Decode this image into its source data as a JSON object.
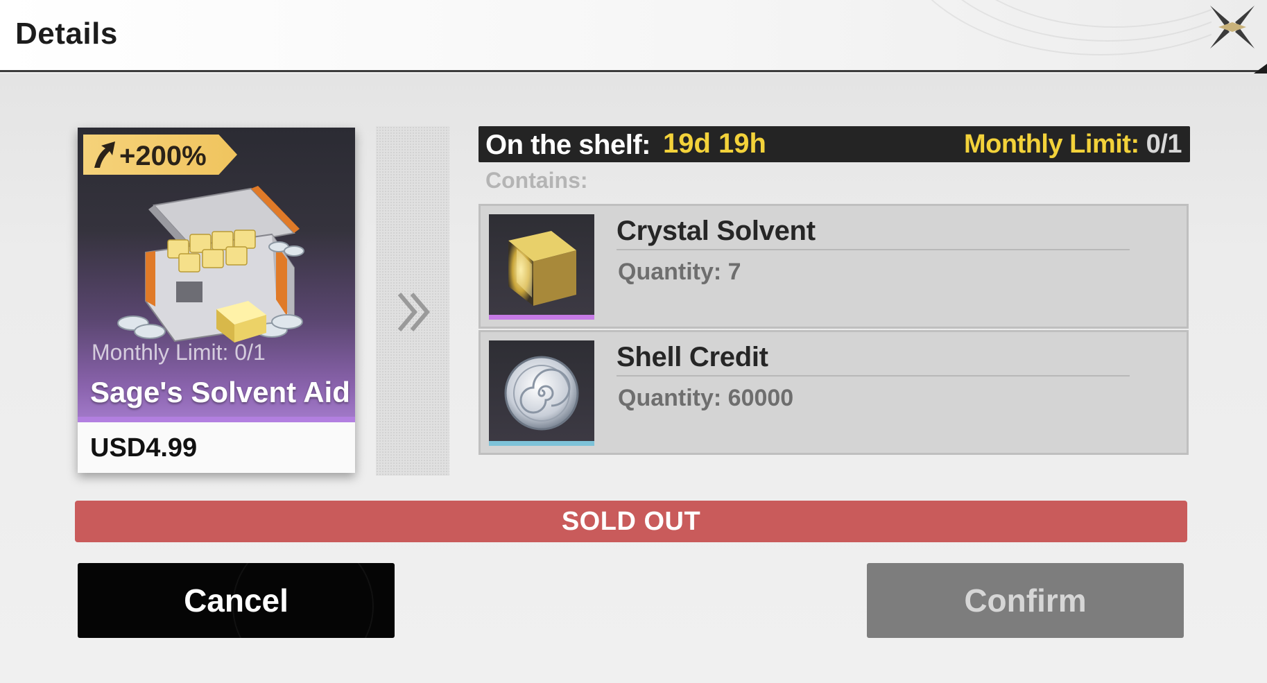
{
  "header": {
    "title": "Details",
    "close_icon": "close-x-icon"
  },
  "product": {
    "bonus": "+200%",
    "bonus_icon": "arrow-up-icon",
    "monthly_limit": "Monthly Limit: 0/1",
    "name": "Sage's Solvent Aid",
    "price": "USD4.99",
    "image": "treasure-chest-icon",
    "art_color": "#8a63ad"
  },
  "divider": {
    "icon": "double-chevron-right-icon"
  },
  "shelf": {
    "label": "On the shelf:",
    "value": "19d 19h",
    "limit_label": "Monthly Limit:",
    "limit_value": "0/1"
  },
  "contains": {
    "label": "Contains:",
    "items": [
      {
        "name": "Crystal Solvent",
        "quantity": "Quantity: 7",
        "icon": "crystal-cube-icon",
        "rarity_color": "#c77be6"
      },
      {
        "name": "Shell Credit",
        "quantity": "Quantity: 60000",
        "icon": "shell-coin-icon",
        "rarity_color": "#7ec2d8"
      }
    ]
  },
  "status": {
    "sold_out": "SOLD OUT",
    "color": "#c95b5b"
  },
  "actions": {
    "cancel": "Cancel",
    "confirm": "Confirm"
  }
}
